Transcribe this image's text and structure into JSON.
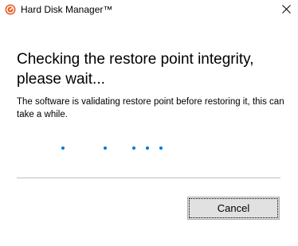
{
  "window": {
    "title": "Hard Disk Manager™",
    "app_icon": "hard-disk-manager-icon",
    "close_icon": "close-icon"
  },
  "main": {
    "heading": "Checking the restore point integrity, please wait...",
    "description": "The software is validating restore point before restoring it, this can take a while.",
    "progress_indicator": {
      "type": "animated-dots",
      "dot_count": 5,
      "color": "#0078d7"
    }
  },
  "footer": {
    "cancel_label": "Cancel"
  },
  "colors": {
    "background": "#ffffff",
    "accent": "#0078d7",
    "icon_orange": "#e8612c",
    "button_face": "#e1e1e1",
    "button_border": "#adadad",
    "divider": "#bfbfbf"
  }
}
